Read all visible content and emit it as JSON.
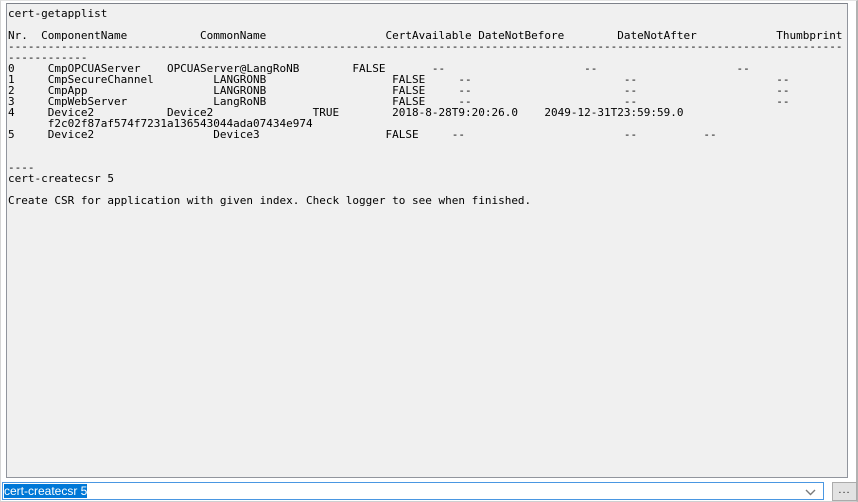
{
  "colors": {
    "console_background": "#f0f0f0",
    "console_text": "#000000",
    "selection_background": "#0078d7",
    "selection_text": "#ffffff",
    "focus_border": "#4a97e2"
  },
  "console": {
    "lines": [
      [
        [
          0,
          "cert-getapplist"
        ]
      ],
      [],
      [
        [
          0,
          "Nr."
        ],
        [
          5,
          "ComponentName"
        ],
        [
          29,
          "CommonName"
        ],
        [
          57,
          "CertAvailable"
        ],
        [
          71,
          "DateNotBefore"
        ],
        [
          92,
          "DateNotAfter"
        ],
        [
          116,
          "Thumbprint"
        ]
      ],
      [
        [
          0,
          "------------------------------------------------------------------------------------------------------------------------------"
        ]
      ],
      [
        [
          0,
          "------------"
        ]
      ],
      [
        [
          0,
          "0"
        ],
        [
          6,
          "CmpOPCUAServer"
        ],
        [
          24,
          "OPCUAServer@LangRoNB"
        ],
        [
          52,
          "FALSE"
        ],
        [
          64,
          "--"
        ],
        [
          87,
          "--"
        ],
        [
          110,
          "--"
        ]
      ],
      [
        [
          0,
          "1"
        ],
        [
          6,
          "CmpSecureChannel"
        ],
        [
          31,
          "LANGRONB"
        ],
        [
          58,
          "FALSE"
        ],
        [
          68,
          "--"
        ],
        [
          93,
          "--"
        ],
        [
          116,
          "--"
        ]
      ],
      [
        [
          0,
          "2"
        ],
        [
          6,
          "CmpApp"
        ],
        [
          31,
          "LANGRONB"
        ],
        [
          58,
          "FALSE"
        ],
        [
          68,
          "--"
        ],
        [
          93,
          "--"
        ],
        [
          116,
          "--"
        ]
      ],
      [
        [
          0,
          "3"
        ],
        [
          6,
          "CmpWebServer"
        ],
        [
          31,
          "LangRoNB"
        ],
        [
          58,
          "FALSE"
        ],
        [
          68,
          "--"
        ],
        [
          93,
          "--"
        ],
        [
          116,
          "--"
        ]
      ],
      [
        [
          0,
          "4"
        ],
        [
          6,
          "Device2"
        ],
        [
          24,
          "Device2"
        ],
        [
          46,
          "TRUE"
        ],
        [
          58,
          "2018-8-28T9:20:26.0"
        ],
        [
          81,
          "2049-12-31T23:59:59.0"
        ]
      ],
      [
        [
          6,
          "f2c02f87af574f7231a136543044ada07434e974"
        ]
      ],
      [
        [
          0,
          "5"
        ],
        [
          6,
          "Device2"
        ],
        [
          31,
          "Device3"
        ],
        [
          57,
          "FALSE"
        ],
        [
          67,
          "--"
        ],
        [
          93,
          "--"
        ],
        [
          105,
          "--"
        ]
      ],
      [],
      [],
      [
        [
          0,
          "----"
        ]
      ],
      [
        [
          0,
          "cert-createcsr 5"
        ]
      ],
      [],
      [
        [
          0,
          "Create CSR for application with given index. Check logger to see when finished."
        ]
      ]
    ]
  },
  "command_bar": {
    "input_value": "cert-createcsr 5",
    "input_selected": true,
    "dropdown_icon": "chevron-down",
    "more_button_label": "..."
  }
}
